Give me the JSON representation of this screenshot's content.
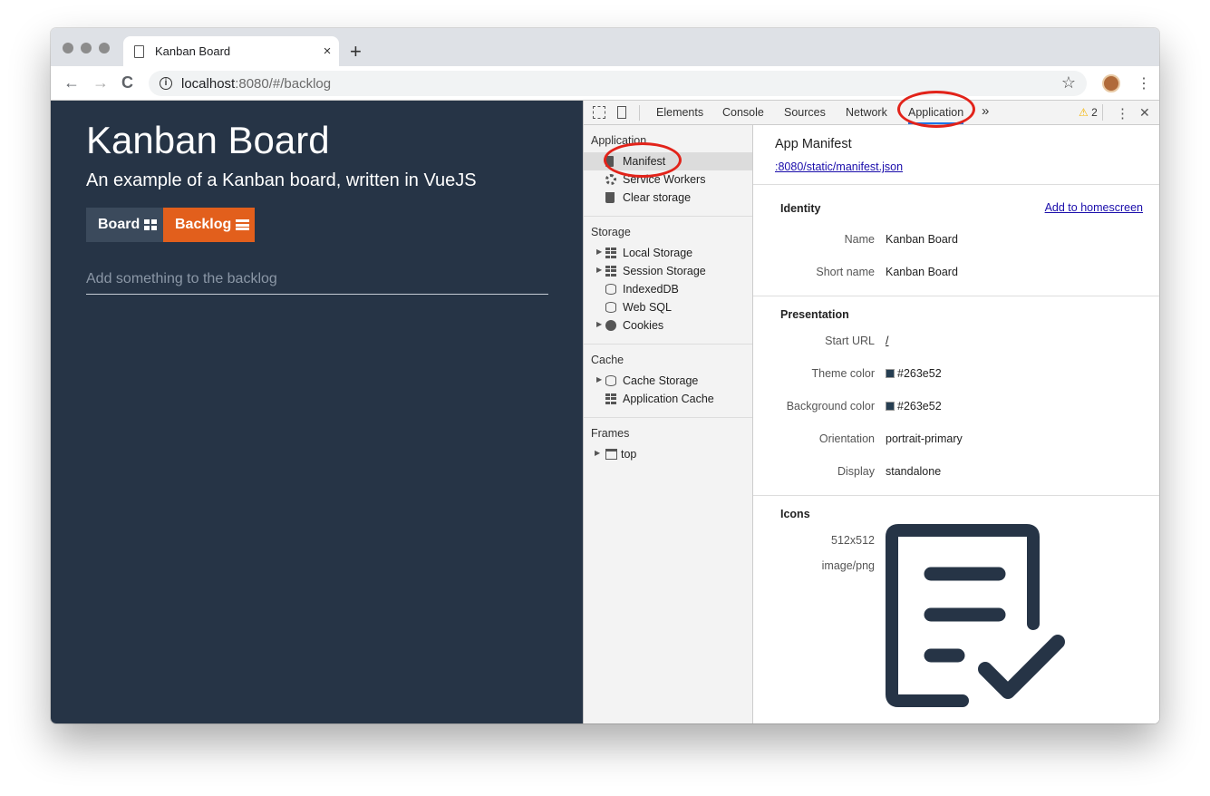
{
  "browser": {
    "tab_title": "Kanban Board",
    "tab_close": "×",
    "new_tab": "+",
    "url_host": "localhost",
    "url_rest": ":8080/#/backlog",
    "back": "←",
    "forward": "→",
    "reload": "C",
    "star": "☆",
    "menu": "⋮"
  },
  "app": {
    "title": "Kanban Board",
    "subtitle": "An example of a Kanban board, written in VueJS",
    "board_label": "Board",
    "backlog_label": "Backlog",
    "input_placeholder": "Add something to the backlog",
    "colors": {
      "background": "#263446",
      "accent": "#e25f1c",
      "board_button": "#3b4a5c"
    }
  },
  "devtools": {
    "tabs": [
      "Elements",
      "Console",
      "Sources",
      "Network",
      "Application"
    ],
    "active_tab": "Application",
    "more": "»",
    "warning_count": "2",
    "warning_icon": "⚠",
    "menu": "⋮",
    "close": "✕",
    "sidebar": {
      "application_header": "Application",
      "application_items": [
        "Manifest",
        "Service Workers",
        "Clear storage"
      ],
      "storage_header": "Storage",
      "storage_items": [
        "Local Storage",
        "Session Storage",
        "IndexedDB",
        "Web SQL",
        "Cookies"
      ],
      "cache_header": "Cache",
      "cache_items": [
        "Cache Storage",
        "Application Cache"
      ],
      "frames_header": "Frames",
      "frames_items": [
        "top"
      ]
    },
    "manifest": {
      "title": "App Manifest",
      "url": ":8080/static/manifest.json",
      "identity_header": "Identity",
      "add_to_homescreen": "Add to homescreen",
      "name_label": "Name",
      "name_value": "Kanban Board",
      "short_name_label": "Short name",
      "short_name_value": "Kanban Board",
      "presentation_header": "Presentation",
      "start_url_label": "Start URL",
      "start_url_value": "/",
      "theme_color_label": "Theme color",
      "theme_color_value": "#263e52",
      "background_color_label": "Background color",
      "background_color_value": "#263e52",
      "orientation_label": "Orientation",
      "orientation_value": "portrait-primary",
      "display_label": "Display",
      "display_value": "standalone",
      "icons_header": "Icons",
      "icon_size": "512x512",
      "icon_type": "image/png",
      "icon_color": "#263446"
    }
  },
  "annotations": {
    "ring_color": "#e2231a"
  }
}
